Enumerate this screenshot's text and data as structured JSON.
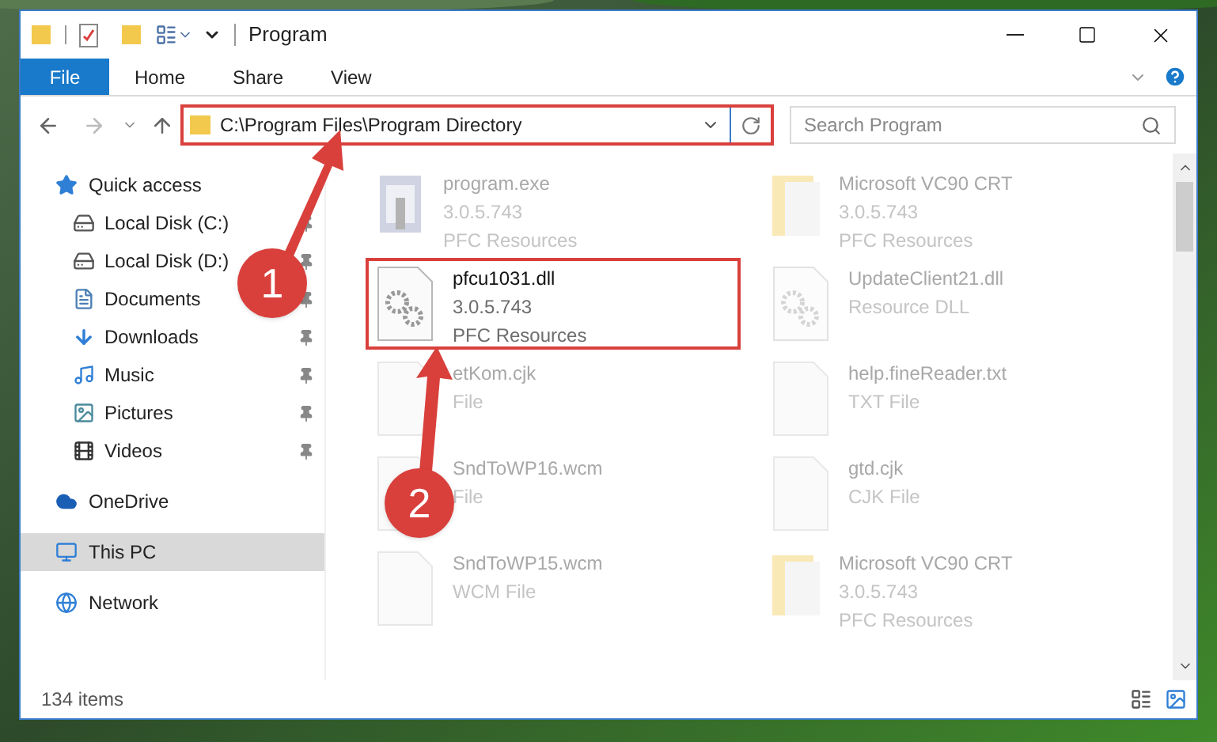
{
  "title_bar": {
    "title": "Program"
  },
  "ribbon": {
    "tabs": [
      {
        "label": "File",
        "selected": true
      },
      {
        "label": "Home",
        "selected": false
      },
      {
        "label": "Share",
        "selected": false
      },
      {
        "label": "View",
        "selected": false
      }
    ]
  },
  "address_bar": {
    "path": "C:\\Program Files\\Program Directory",
    "highlighted": true
  },
  "search": {
    "placeholder": "Search Program"
  },
  "sidebar": {
    "items": [
      {
        "label": "Quick access",
        "selected": false,
        "children": [
          {
            "label": "Local Disk (C:)",
            "pinned": true
          },
          {
            "label": "Local Disk (D:)",
            "pinned": true
          },
          {
            "label": "Documents",
            "pinned": true
          },
          {
            "label": "Downloads",
            "pinned": true
          },
          {
            "label": "Music",
            "pinned": true
          },
          {
            "label": "Pictures",
            "pinned": true
          },
          {
            "label": "Videos",
            "pinned": true
          }
        ]
      },
      {
        "label": "OneDrive",
        "selected": false
      },
      {
        "label": "This PC",
        "selected": true
      },
      {
        "label": "Network",
        "selected": false
      }
    ]
  },
  "files": [
    {
      "kind": "exe",
      "name": "program.exe",
      "details": [
        "3.0.5.743",
        "PFC Resources"
      ],
      "highlighted": false
    },
    {
      "kind": "folder",
      "name": "Microsoft VC90 CRT",
      "details": [
        "3.0.5.743",
        "PFC Resources"
      ],
      "highlighted": false
    },
    {
      "kind": "dll",
      "name": "pfcu1031.dll",
      "details": [
        "3.0.5.743",
        "PFC Resources"
      ],
      "highlighted": true
    },
    {
      "kind": "dll",
      "name": "UpdateClient21.dll",
      "details": [
        "Resource DLL"
      ],
      "highlighted": false
    },
    {
      "kind": "doc",
      "name": "etKom.cjk",
      "details": [
        "File"
      ],
      "highlighted": false
    },
    {
      "kind": "doc",
      "name": "help.fineReader.txt",
      "details": [
        "TXT File"
      ],
      "highlighted": false
    },
    {
      "kind": "doc",
      "name": "SndToWP16.wcm",
      "details": [
        "File"
      ],
      "highlighted": false
    },
    {
      "kind": "doc",
      "name": "gtd.cjk",
      "details": [
        "CJK File"
      ],
      "highlighted": false
    },
    {
      "kind": "doc",
      "name": "SndToWP15.wcm",
      "details": [
        "WCM File"
      ],
      "highlighted": false
    },
    {
      "kind": "folder",
      "name": "Microsoft VC90 CRT",
      "details": [
        "3.0.5.743",
        "PFC Resources"
      ],
      "highlighted": false
    }
  ],
  "status_bar": {
    "count": "134 items"
  },
  "annotations": [
    {
      "label": "1"
    },
    {
      "label": "2"
    }
  ]
}
